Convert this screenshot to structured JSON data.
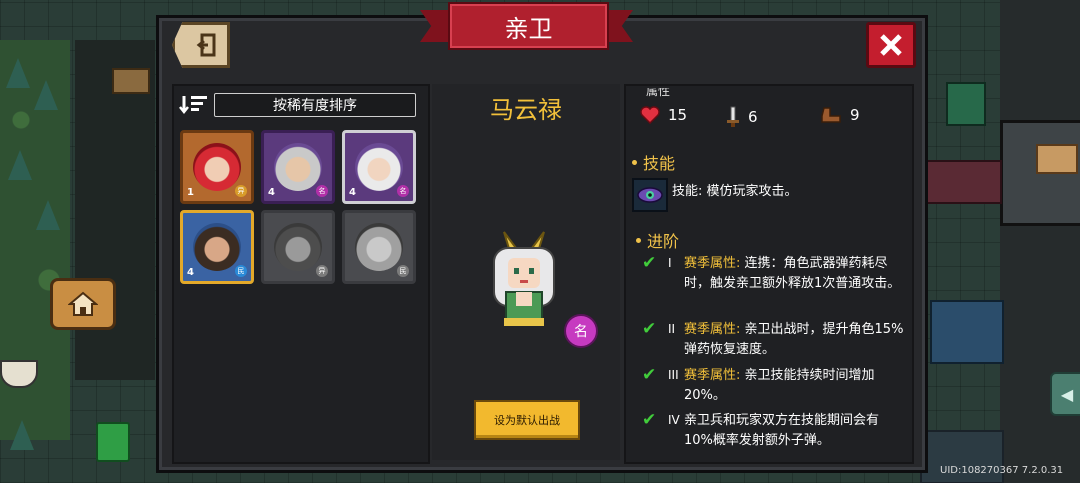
{
  "window": {
    "title": "亲卫"
  },
  "sort": {
    "label": "按稀有度排序"
  },
  "roster": [
    {
      "level": "1",
      "rank": "异"
    },
    {
      "level": "4",
      "rank": "名"
    },
    {
      "level": "4",
      "rank": "名"
    },
    {
      "level": "4",
      "rank": "民"
    },
    {
      "level": "",
      "rank": "异"
    },
    {
      "level": "",
      "rank": "民"
    }
  ],
  "character": {
    "name": "马云禄",
    "rarity": "名",
    "default_button": "设为默认出战"
  },
  "attributes": {
    "title": "属性",
    "hp": "15",
    "attack": "6",
    "speed": "9"
  },
  "skill": {
    "title": "技能",
    "text": "技能: 模仿玩家攻击。"
  },
  "upgrade": {
    "title": "进阶",
    "tiers": [
      {
        "roman": "I",
        "label": "赛季属性:",
        "text": "连携：角色武器弹药耗尽时，触发亲卫额外释放1次普通攻击。"
      },
      {
        "roman": "II",
        "label": "赛季属性:",
        "text": "亲卫出战时，提升角色15%弹药恢复速度。"
      },
      {
        "roman": "III",
        "label": "赛季属性:",
        "text": "亲卫技能持续时间增加20%。"
      },
      {
        "roman": "IV",
        "label": "",
        "text": "亲卫兵和玩家双方在技能期间会有10%概率发射额外子弹。"
      }
    ]
  },
  "footer": {
    "uid": "UID:108270367 7.2.0.31"
  },
  "icons": {
    "back": "back-door-icon",
    "close": "close-x-icon",
    "home": "home-icon",
    "sort": "sort-descending-icon",
    "hp": "heart-icon",
    "attack": "sword-icon",
    "speed": "boot-icon",
    "skill": "eye-icon",
    "check": "check-icon"
  },
  "colors": {
    "accent_gold": "#f2c03a",
    "title_red": "#b0202e",
    "check_green": "#41cc3b",
    "rarity_purple": "#c63ac0"
  }
}
